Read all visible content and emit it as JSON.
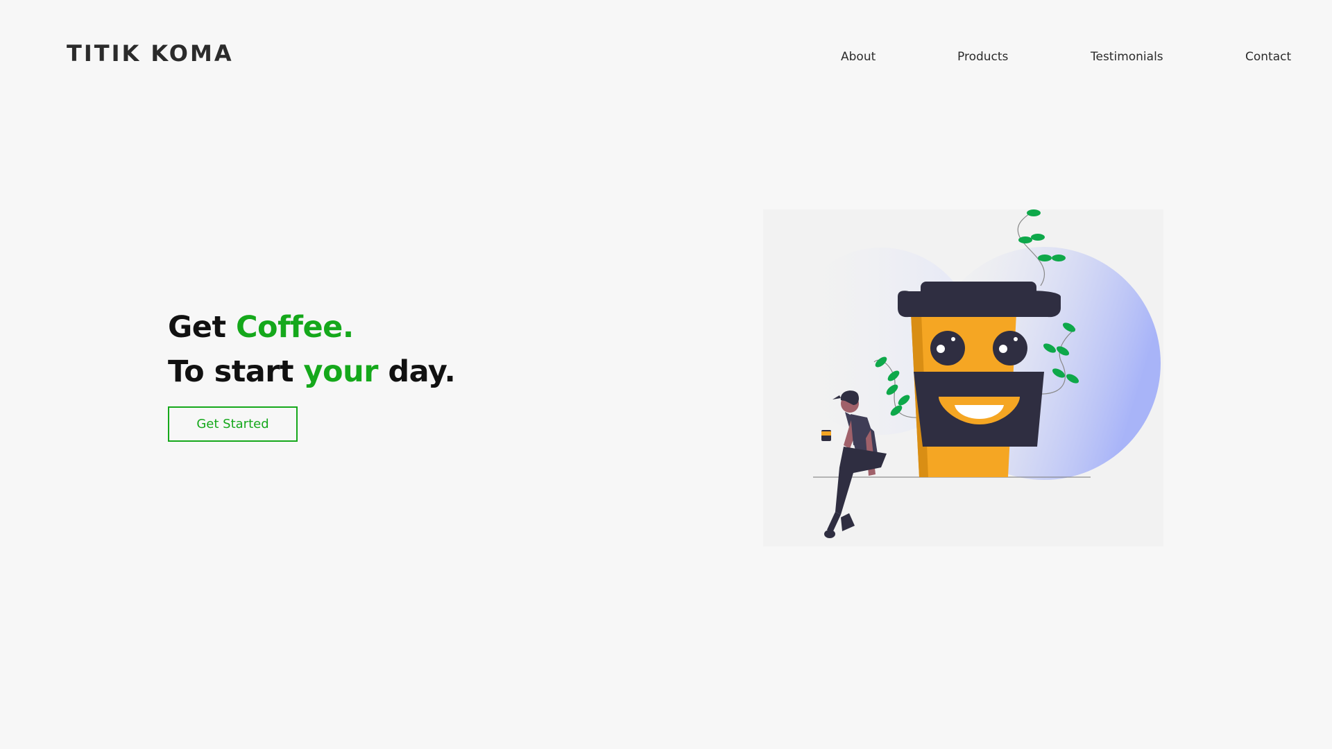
{
  "header": {
    "brand": "TITIK KOMA",
    "nav": [
      {
        "label": "About"
      },
      {
        "label": "Products"
      },
      {
        "label": "Testimonials"
      },
      {
        "label": "Contact"
      }
    ]
  },
  "hero": {
    "line1_a": "Get ",
    "line1_b": "Coffee.",
    "line2_a": "To start ",
    "line2_b": "your",
    "line2_c": " day.",
    "cta_label": "Get Started"
  },
  "colors": {
    "background": "#f7f7f7",
    "accent": "#15a81b",
    "text": "#111111",
    "cup": "#f5a623",
    "cup_dark": "#2f2e41",
    "leaf": "#0ea84a",
    "blob": "#a8b4f8"
  }
}
